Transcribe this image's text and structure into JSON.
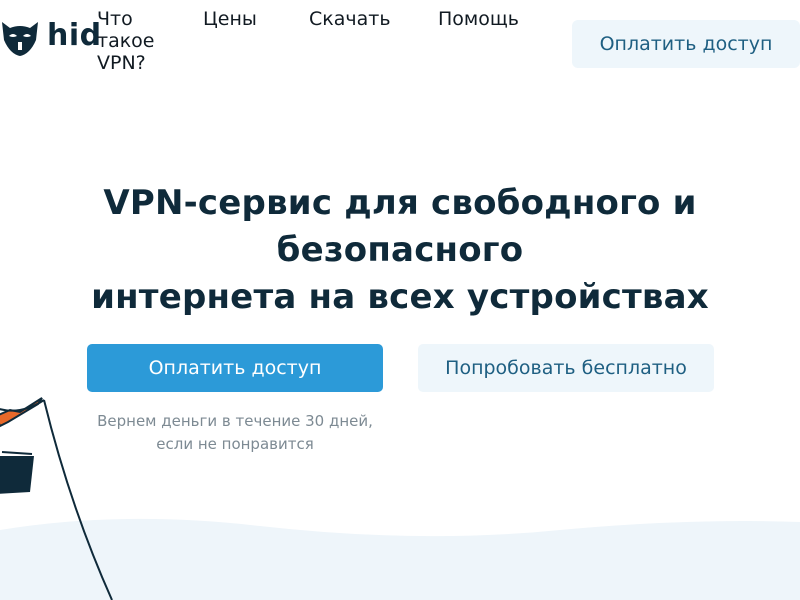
{
  "header": {
    "logo_text": "hide",
    "nav": {
      "what_is_vpn": "Что такое VPN?",
      "prices": "Цены",
      "download": "Скачать",
      "help": "Помощь"
    },
    "cta_label": "Оплатить доступ"
  },
  "hero": {
    "title_line1": "VPN-сервис для свободного и безопасного",
    "title_line2": "интернета на всех устройствах",
    "primary_button": "Оплатить доступ",
    "secondary_button": "Попробовать бесплатно",
    "refund_line1": "Вернем деньги в течение 30 дней,",
    "refund_line2": "если не понравится"
  },
  "colors": {
    "primary": "#2c9ad8",
    "secondary_bg": "#eef6fb",
    "secondary_text": "#1e5f82",
    "heading": "#0f2a3a",
    "muted": "#7d8a93",
    "wave": "#eef5fa"
  },
  "icons": {
    "logo": "mask-icon",
    "illustration": "hammock-illustration"
  }
}
